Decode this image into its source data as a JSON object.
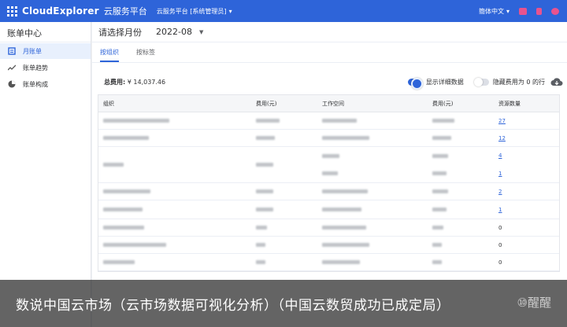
{
  "header": {
    "brand": "CloudExplorer",
    "brand_sub": "云服务平台",
    "context": "云服务平台 [系统管理员]",
    "lang": "簡体中文",
    "accent": "#2e64d9",
    "icons": [
      "apps-grid-icon",
      "mail-icon",
      "notification-icon",
      "user-icon"
    ]
  },
  "sidebar": {
    "title": "账单中心",
    "items": [
      {
        "label": "月账单",
        "icon": "calendar-icon",
        "active": true
      },
      {
        "label": "账单趋势",
        "icon": "trend-icon",
        "active": false
      },
      {
        "label": "账单构成",
        "icon": "pie-chart-icon",
        "active": false
      }
    ]
  },
  "main": {
    "month_label": "请选择月份",
    "month_value": "2022-08",
    "tabs": [
      {
        "label": "按组织",
        "active": true
      },
      {
        "label": "按标签",
        "active": false
      }
    ],
    "total_label": "总费用:",
    "total_value": "¥ 14,037.46",
    "switch_detail": "显示详细数据",
    "switch_hide": "隐藏费用为 0 的行",
    "columns": [
      "组织",
      "费用(元)",
      "工作空间",
      "费用(元)",
      "资源数量"
    ],
    "rows": [
      {
        "counts": [
          "27"
        ]
      },
      {
        "counts": [
          "12"
        ]
      },
      {
        "counts": [
          "4",
          "1"
        ]
      },
      {
        "counts": [
          "2"
        ]
      },
      {
        "counts": [
          "1"
        ]
      },
      {
        "counts": [
          "0"
        ]
      },
      {
        "counts": [
          "0"
        ]
      },
      {
        "counts": [
          "0"
        ]
      }
    ]
  },
  "caption": {
    "text": "数说中国云市场（云市场数据可视化分析）（中国云数贸成功已成定局）",
    "watermark": "⑩醒醒"
  }
}
